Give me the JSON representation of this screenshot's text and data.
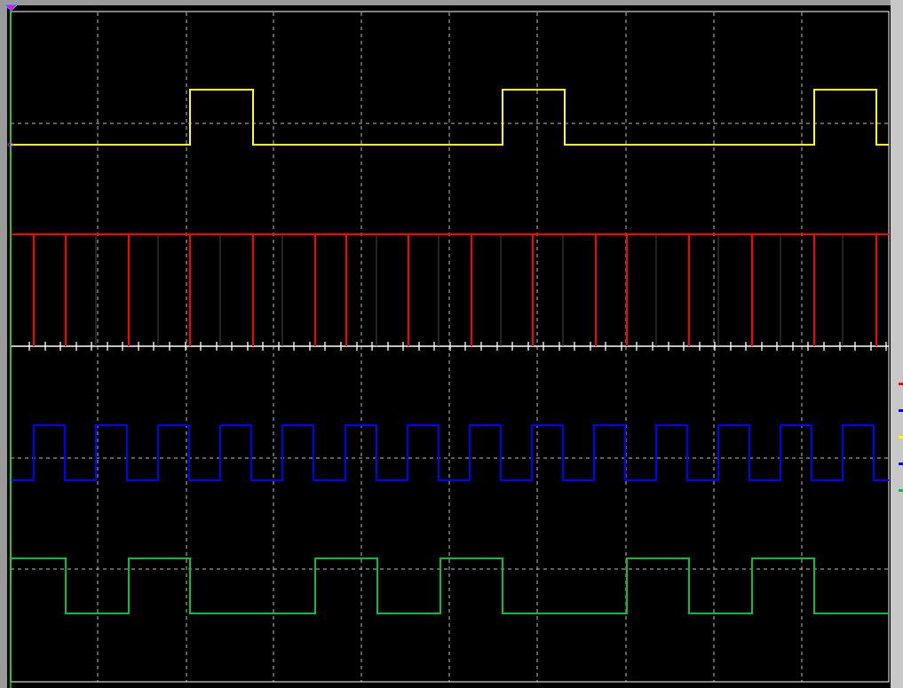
{
  "traces": [
    {
      "color": "#ffff00"
    },
    {
      "color": "#ff0000"
    },
    {
      "color": "#0000ff"
    },
    {
      "color": "#00c040"
    }
  ],
  "side_markers": [
    {
      "color": "#ff0000"
    },
    {
      "color": "#0000ff"
    },
    {
      "color": "#ffff00"
    },
    {
      "color": "#0000ff"
    },
    {
      "color": "#00c040"
    }
  ]
}
